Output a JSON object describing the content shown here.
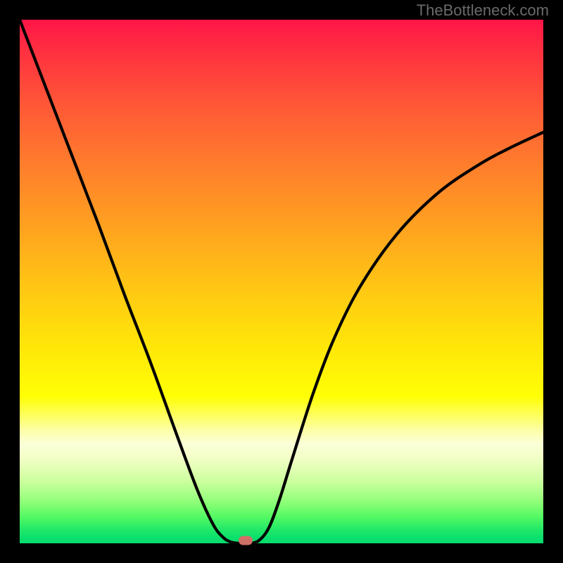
{
  "watermark": "TheBottleneck.com",
  "chart_data": {
    "type": "line",
    "title": "",
    "xlabel": "",
    "ylabel": "",
    "xlim": [
      0,
      1
    ],
    "ylim": [
      0,
      1
    ],
    "grid": false,
    "series": [
      {
        "name": "bottleneck-curve",
        "x": [
          0.0,
          0.05,
          0.1,
          0.15,
          0.2,
          0.25,
          0.3,
          0.34,
          0.37,
          0.39,
          0.405,
          0.42,
          0.435,
          0.455,
          0.475,
          0.495,
          0.52,
          0.56,
          0.6,
          0.65,
          0.72,
          0.8,
          0.88,
          0.94,
          1.0
        ],
        "y": [
          1.0,
          0.87,
          0.74,
          0.61,
          0.475,
          0.345,
          0.207,
          0.1,
          0.035,
          0.01,
          0.002,
          0.0,
          0.0,
          0.004,
          0.028,
          0.08,
          0.16,
          0.285,
          0.39,
          0.49,
          0.59,
          0.67,
          0.725,
          0.757,
          0.785
        ]
      }
    ],
    "marker": {
      "x": 0.432,
      "y": 0.005,
      "color": "#cf7067"
    },
    "background_gradient": {
      "stops": [
        {
          "pos": 0.0,
          "color": "#ff1548"
        },
        {
          "pos": 0.5,
          "color": "#ffc800"
        },
        {
          "pos": 0.8,
          "color": "#fcffc0"
        },
        {
          "pos": 1.0,
          "color": "#07dc6e"
        }
      ]
    }
  }
}
